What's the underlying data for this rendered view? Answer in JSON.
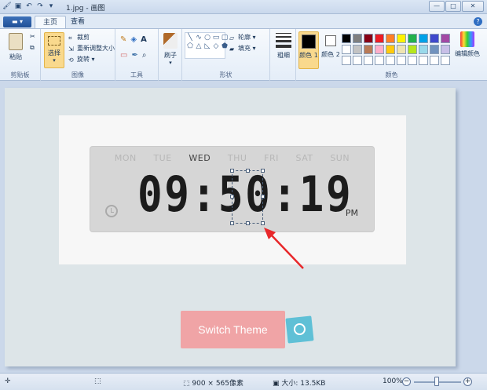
{
  "window": {
    "title": "1.jpg - 画图",
    "minimize": "—",
    "maximize": "□",
    "close": "✕"
  },
  "tabs": {
    "file": "▬ ▾",
    "home": "主页",
    "view": "查看"
  },
  "ribbon": {
    "clipboard": {
      "label": "剪贴板",
      "paste": "粘贴"
    },
    "image": {
      "label": "图像",
      "select": "选择",
      "crop": "裁剪",
      "resize": "重新调整大小",
      "rotate": "旋转"
    },
    "tools": {
      "label": "工具"
    },
    "brushes": {
      "label": "刷子"
    },
    "shapes": {
      "label": "形状",
      "outline": "轮廓",
      "fill": "填充"
    },
    "size": {
      "label": "粗细"
    },
    "colors": {
      "label": "颜色",
      "color1": "颜色 1",
      "color2": "颜色 2",
      "edit": "编辑颜色",
      "palette": [
        "#000000",
        "#7f7f7f",
        "#880015",
        "#ed1c24",
        "#ff7f27",
        "#fff200",
        "#22b14c",
        "#00a2e8",
        "#3f48cc",
        "#a349a4",
        "#ffffff",
        "#c3c3c3",
        "#b97a57",
        "#ffaec9",
        "#ffc90e",
        "#efe4b0",
        "#b5e61d",
        "#99d9ea",
        "#7092be",
        "#c8bfe7",
        "#ffffff",
        "#ffffff",
        "#ffffff",
        "#ffffff",
        "#ffffff",
        "#ffffff",
        "#ffffff",
        "#ffffff",
        "#ffffff",
        "#ffffff"
      ]
    }
  },
  "image_content": {
    "days": [
      "MON",
      "TUE",
      "WED",
      "THU",
      "FRI",
      "SAT",
      "SUN"
    ],
    "active_day": "WED",
    "time": "09:50:19",
    "ampm": "PM",
    "switch_button": "Switch Theme"
  },
  "status": {
    "dimensions": "900 × 565像素",
    "filesize": "大小: 13.5KB",
    "zoom": "100%"
  }
}
